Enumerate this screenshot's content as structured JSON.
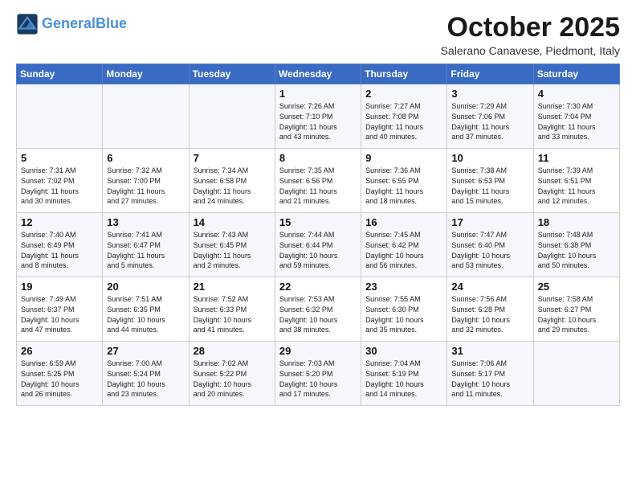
{
  "header": {
    "logo_general": "General",
    "logo_blue": "Blue",
    "month_title": "October 2025",
    "location": "Salerano Canavese, Piedmont, Italy"
  },
  "weekdays": [
    "Sunday",
    "Monday",
    "Tuesday",
    "Wednesday",
    "Thursday",
    "Friday",
    "Saturday"
  ],
  "weeks": [
    [
      {
        "day": "",
        "info": ""
      },
      {
        "day": "",
        "info": ""
      },
      {
        "day": "",
        "info": ""
      },
      {
        "day": "1",
        "info": "Sunrise: 7:26 AM\nSunset: 7:10 PM\nDaylight: 11 hours\nand 43 minutes."
      },
      {
        "day": "2",
        "info": "Sunrise: 7:27 AM\nSunset: 7:08 PM\nDaylight: 11 hours\nand 40 minutes."
      },
      {
        "day": "3",
        "info": "Sunrise: 7:29 AM\nSunset: 7:06 PM\nDaylight: 11 hours\nand 37 minutes."
      },
      {
        "day": "4",
        "info": "Sunrise: 7:30 AM\nSunset: 7:04 PM\nDaylight: 11 hours\nand 33 minutes."
      }
    ],
    [
      {
        "day": "5",
        "info": "Sunrise: 7:31 AM\nSunset: 7:02 PM\nDaylight: 11 hours\nand 30 minutes."
      },
      {
        "day": "6",
        "info": "Sunrise: 7:32 AM\nSunset: 7:00 PM\nDaylight: 11 hours\nand 27 minutes."
      },
      {
        "day": "7",
        "info": "Sunrise: 7:34 AM\nSunset: 6:58 PM\nDaylight: 11 hours\nand 24 minutes."
      },
      {
        "day": "8",
        "info": "Sunrise: 7:35 AM\nSunset: 6:56 PM\nDaylight: 11 hours\nand 21 minutes."
      },
      {
        "day": "9",
        "info": "Sunrise: 7:36 AM\nSunset: 6:55 PM\nDaylight: 11 hours\nand 18 minutes."
      },
      {
        "day": "10",
        "info": "Sunrise: 7:38 AM\nSunset: 6:53 PM\nDaylight: 11 hours\nand 15 minutes."
      },
      {
        "day": "11",
        "info": "Sunrise: 7:39 AM\nSunset: 6:51 PM\nDaylight: 11 hours\nand 12 minutes."
      }
    ],
    [
      {
        "day": "12",
        "info": "Sunrise: 7:40 AM\nSunset: 6:49 PM\nDaylight: 11 hours\nand 8 minutes."
      },
      {
        "day": "13",
        "info": "Sunrise: 7:41 AM\nSunset: 6:47 PM\nDaylight: 11 hours\nand 5 minutes."
      },
      {
        "day": "14",
        "info": "Sunrise: 7:43 AM\nSunset: 6:45 PM\nDaylight: 11 hours\nand 2 minutes."
      },
      {
        "day": "15",
        "info": "Sunrise: 7:44 AM\nSunset: 6:44 PM\nDaylight: 10 hours\nand 59 minutes."
      },
      {
        "day": "16",
        "info": "Sunrise: 7:45 AM\nSunset: 6:42 PM\nDaylight: 10 hours\nand 56 minutes."
      },
      {
        "day": "17",
        "info": "Sunrise: 7:47 AM\nSunset: 6:40 PM\nDaylight: 10 hours\nand 53 minutes."
      },
      {
        "day": "18",
        "info": "Sunrise: 7:48 AM\nSunset: 6:38 PM\nDaylight: 10 hours\nand 50 minutes."
      }
    ],
    [
      {
        "day": "19",
        "info": "Sunrise: 7:49 AM\nSunset: 6:37 PM\nDaylight: 10 hours\nand 47 minutes."
      },
      {
        "day": "20",
        "info": "Sunrise: 7:51 AM\nSunset: 6:35 PM\nDaylight: 10 hours\nand 44 minutes."
      },
      {
        "day": "21",
        "info": "Sunrise: 7:52 AM\nSunset: 6:33 PM\nDaylight: 10 hours\nand 41 minutes."
      },
      {
        "day": "22",
        "info": "Sunrise: 7:53 AM\nSunset: 6:32 PM\nDaylight: 10 hours\nand 38 minutes."
      },
      {
        "day": "23",
        "info": "Sunrise: 7:55 AM\nSunset: 6:30 PM\nDaylight: 10 hours\nand 35 minutes."
      },
      {
        "day": "24",
        "info": "Sunrise: 7:56 AM\nSunset: 6:28 PM\nDaylight: 10 hours\nand 32 minutes."
      },
      {
        "day": "25",
        "info": "Sunrise: 7:58 AM\nSunset: 6:27 PM\nDaylight: 10 hours\nand 29 minutes."
      }
    ],
    [
      {
        "day": "26",
        "info": "Sunrise: 6:59 AM\nSunset: 5:25 PM\nDaylight: 10 hours\nand 26 minutes."
      },
      {
        "day": "27",
        "info": "Sunrise: 7:00 AM\nSunset: 5:24 PM\nDaylight: 10 hours\nand 23 minutes."
      },
      {
        "day": "28",
        "info": "Sunrise: 7:02 AM\nSunset: 5:22 PM\nDaylight: 10 hours\nand 20 minutes."
      },
      {
        "day": "29",
        "info": "Sunrise: 7:03 AM\nSunset: 5:20 PM\nDaylight: 10 hours\nand 17 minutes."
      },
      {
        "day": "30",
        "info": "Sunrise: 7:04 AM\nSunset: 5:19 PM\nDaylight: 10 hours\nand 14 minutes."
      },
      {
        "day": "31",
        "info": "Sunrise: 7:06 AM\nSunset: 5:17 PM\nDaylight: 10 hours\nand 11 minutes."
      },
      {
        "day": "",
        "info": ""
      }
    ]
  ]
}
